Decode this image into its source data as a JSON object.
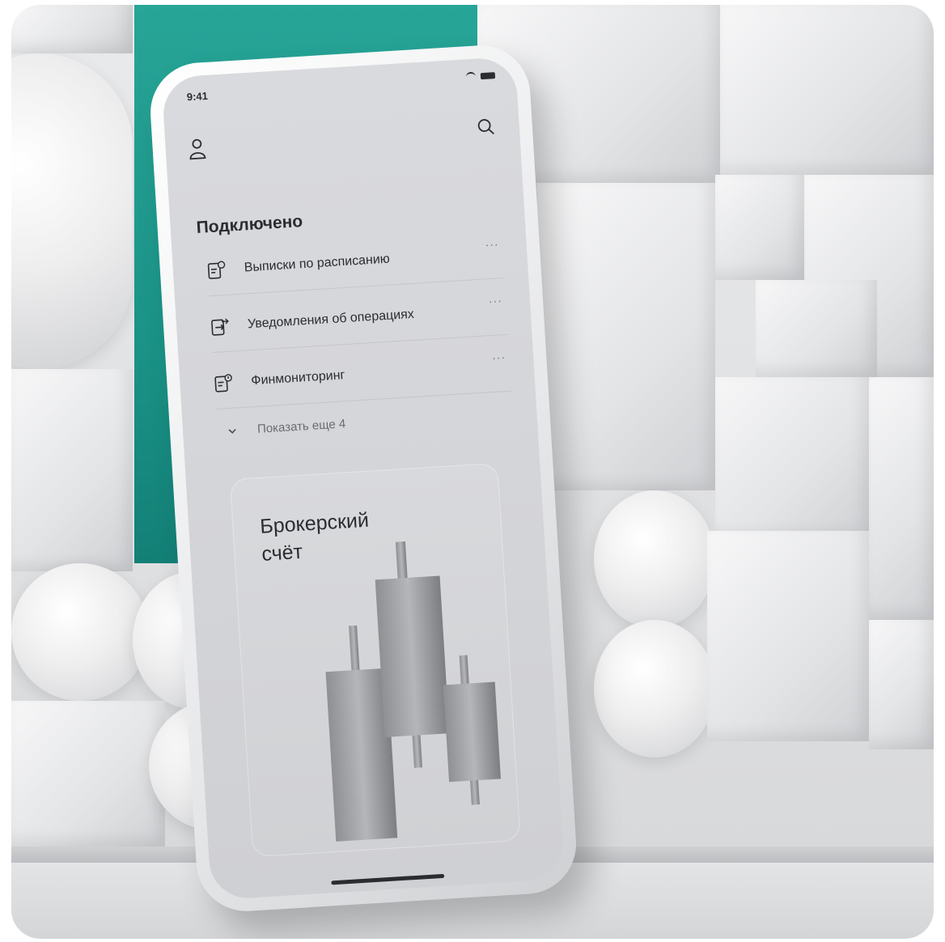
{
  "status_bar": {
    "time": "9:41"
  },
  "connected": {
    "title": "Подключено",
    "items": [
      {
        "label": "Выписки по расписанию",
        "icon": "scheduled-statement-icon",
        "more": "···"
      },
      {
        "label": "Уведомления об операциях",
        "icon": "operation-notifications-icon",
        "more": "···"
      },
      {
        "label": "Финмониторинг",
        "icon": "finmonitoring-icon",
        "more": "···"
      }
    ],
    "show_more_label": "Показать еще 4"
  },
  "broker_card": {
    "title_line1": "Брокерский",
    "title_line2": "счёт"
  },
  "colors": {
    "accent": "#1b9387",
    "screen_bg": "#d4d5d9",
    "text": "#2b2c30"
  }
}
